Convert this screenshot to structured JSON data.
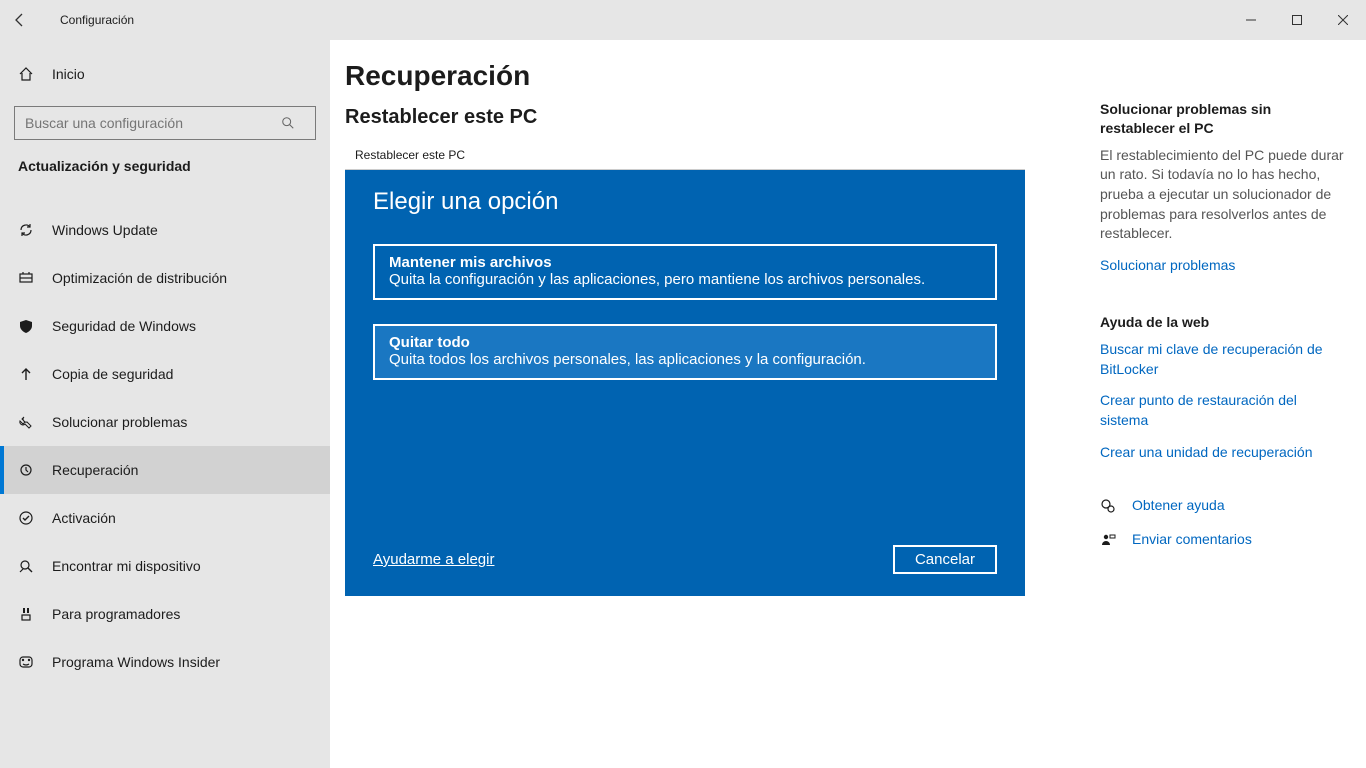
{
  "titlebar": {
    "title": "Configuración"
  },
  "sidebar": {
    "home_label": "Inicio",
    "search_placeholder": "Buscar una configuración",
    "group_header": "Actualización y seguridad",
    "items": [
      {
        "label": "Windows Update",
        "icon": "sync-icon"
      },
      {
        "label": "Optimización de distribución",
        "icon": "delivery-icon"
      },
      {
        "label": "Seguridad de Windows",
        "icon": "shield-icon"
      },
      {
        "label": "Copia de seguridad",
        "icon": "backup-icon"
      },
      {
        "label": "Solucionar problemas",
        "icon": "troubleshoot-icon"
      },
      {
        "label": "Recuperación",
        "icon": "recovery-icon",
        "selected": true
      },
      {
        "label": "Activación",
        "icon": "activation-icon"
      },
      {
        "label": "Encontrar mi dispositivo",
        "icon": "find-device-icon"
      },
      {
        "label": "Para programadores",
        "icon": "developer-icon"
      },
      {
        "label": "Programa Windows Insider",
        "icon": "insider-icon"
      }
    ]
  },
  "main": {
    "page_title": "Recuperación",
    "section_title": "Restablecer este PC"
  },
  "dialog": {
    "window_title": "Restablecer este PC",
    "heading": "Elegir una opción",
    "option_keep": {
      "title": "Mantener mis archivos",
      "desc": "Quita la configuración y las aplicaciones, pero mantiene los archivos personales."
    },
    "option_remove": {
      "title": "Quitar todo",
      "desc": "Quita todos los archivos personales, las aplicaciones y la configuración."
    },
    "help_link": "Ayudarme a elegir",
    "cancel_label": "Cancelar"
  },
  "help": {
    "sec1_title": "Solucionar problemas sin restablecer el PC",
    "sec1_body": "El restablecimiento del PC puede durar un rato. Si todavía no lo has hecho, prueba a ejecutar un solucionador de problemas para resolverlos antes de restablecer.",
    "sec1_link": "Solucionar problemas",
    "sec2_title": "Ayuda de la web",
    "sec2_links": [
      "Buscar mi clave de recuperación de BitLocker",
      "Crear punto de restauración del sistema",
      "Crear una unidad de recuperación"
    ],
    "get_help": "Obtener ayuda",
    "feedback": "Enviar comentarios"
  }
}
